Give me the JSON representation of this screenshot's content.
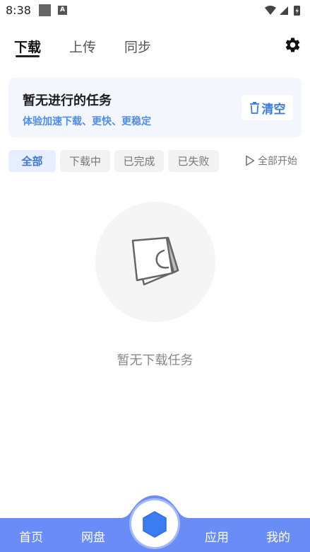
{
  "status_bar": {
    "time": "8:38",
    "notif_letter": "A"
  },
  "tabs": [
    {
      "label": "下载",
      "active": true
    },
    {
      "label": "上传",
      "active": false
    },
    {
      "label": "同步",
      "active": false
    }
  ],
  "settings_icon": "gear-icon",
  "promo": {
    "title": "暂无进行的任务",
    "subtitle": "体验加速下载、更快、更稳定",
    "clear_label": "清空",
    "clear_icon": "trash-icon"
  },
  "filters": [
    {
      "label": "全部",
      "active": true
    },
    {
      "label": "下载中",
      "active": false
    },
    {
      "label": "已完成",
      "active": false
    },
    {
      "label": "已失败",
      "active": false
    }
  ],
  "start_all": {
    "label": "全部开始",
    "icon": "play-icon"
  },
  "empty": {
    "message": "暂无下载任务",
    "icon": "empty-box-icon"
  },
  "bottom_nav": {
    "items": [
      {
        "label": "首页"
      },
      {
        "label": "网盘"
      },
      {
        "label": "应用"
      },
      {
        "label": "我的"
      }
    ],
    "center_icon": "hexagon-icon"
  },
  "colors": {
    "accent": "#3d7ae0",
    "nav_bg": "#6a8cf7",
    "promo_bg": "#f3f6fd",
    "chip_active_bg": "#e6eeff"
  }
}
